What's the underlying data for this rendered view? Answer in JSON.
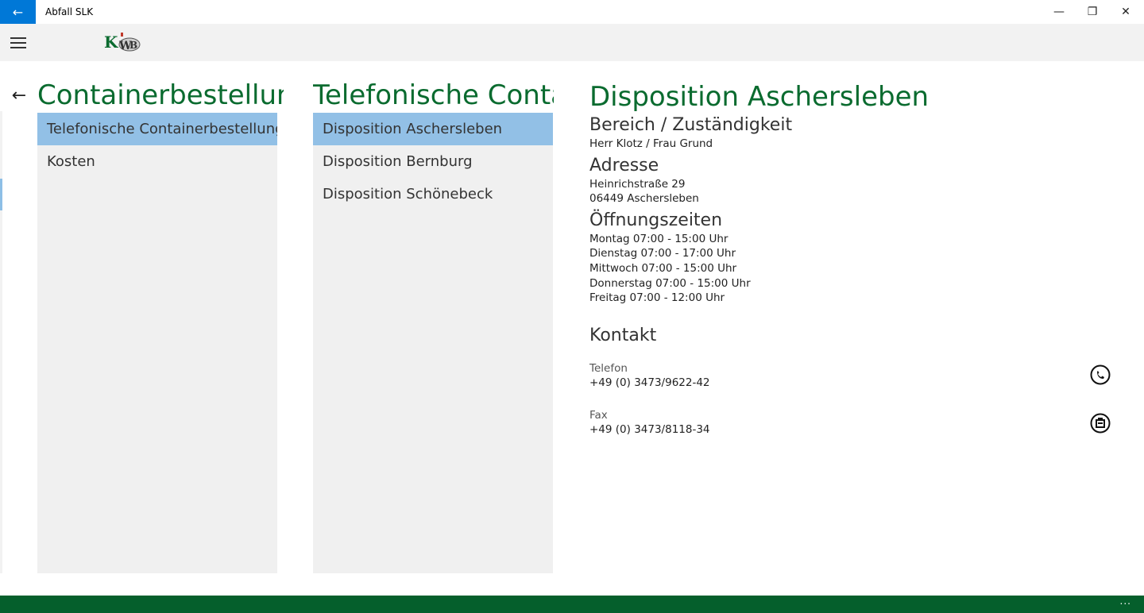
{
  "window": {
    "title": "Abfall SLK",
    "back_icon": "arrow-left-icon",
    "minimize_glyph": "—",
    "maximize_glyph": "❐",
    "close_glyph": "✕"
  },
  "columns": [
    {
      "title": "Containerbestellung",
      "items": [
        {
          "label": "Telefonische Containerbestellung",
          "selected": true
        },
        {
          "label": "Kosten",
          "selected": false
        }
      ]
    },
    {
      "title": "Telefonische Containerbestellung",
      "items": [
        {
          "label": "Disposition Aschersleben",
          "selected": true
        },
        {
          "label": "Disposition Bernburg",
          "selected": false
        },
        {
          "label": "Disposition Schönebeck",
          "selected": false
        }
      ]
    }
  ],
  "detail": {
    "title": "Disposition Aschersleben",
    "bereich_heading": "Bereich / Zuständigkeit",
    "bereich_value": "Herr Klotz / Frau Grund",
    "adresse_heading": "Adresse",
    "adresse_line1": "Heinrichstraße 29",
    "adresse_line2": "06449 Aschersleben",
    "zeiten_heading": "Öffnungszeiten",
    "zeiten": [
      "Montag 07:00 - 15:00 Uhr",
      "Dienstag 07:00 - 17:00 Uhr",
      "Mittwoch 07:00 - 15:00 Uhr",
      "Donnerstag 07:00 - 15:00 Uhr",
      "Freitag 07:00 - 12:00 Uhr"
    ],
    "kontakt_heading": "Kontakt",
    "telefon_label": "Telefon",
    "telefon_value": "+49 (0) 3473/9622-42",
    "fax_label": "Fax",
    "fax_value": "+49 (0) 3473/8118-34"
  },
  "bottombar": {
    "more": "..."
  },
  "colors": {
    "accent_blue": "#0078d7",
    "brand_green": "#0a6b2f",
    "bottom_green": "#055f2c",
    "selected_blue": "#92c0e6"
  }
}
